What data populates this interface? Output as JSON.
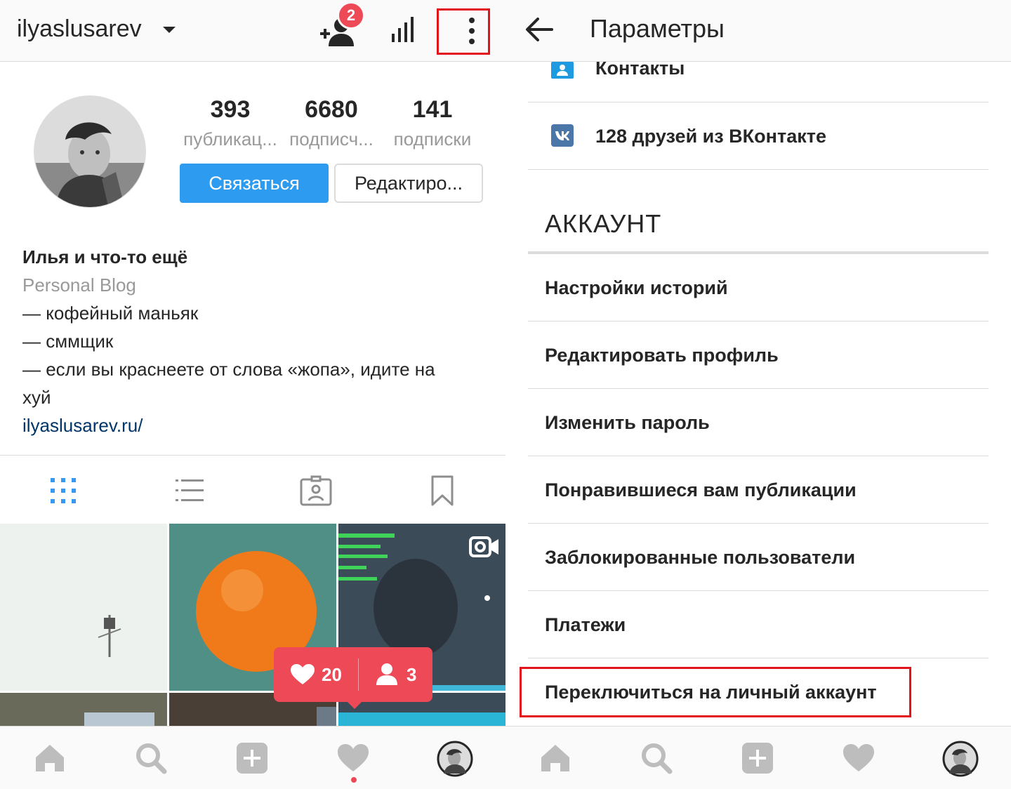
{
  "left": {
    "header": {
      "username": "ilyaslusarev",
      "follow_requests_badge": "2"
    },
    "stats": [
      {
        "value": "393",
        "label": "публикац..."
      },
      {
        "value": "6680",
        "label": "подписч..."
      },
      {
        "value": "141",
        "label": "подписки"
      }
    ],
    "buttons": {
      "contact": "Связаться",
      "edit": "Редактиро..."
    },
    "bio": {
      "name": "Илья и что-то ещё",
      "category": "Personal Blog",
      "lines": [
        "— кофейный маньяк",
        "— сммщик",
        "— если вы краснеете от слова «жопа», идите на",
        "хуй"
      ],
      "link": "ilyaslusarev.ru/"
    },
    "activity_popup": {
      "likes": "20",
      "followers": "3"
    },
    "tabs": [
      "grid-icon",
      "list-icon",
      "tagged-icon",
      "saved-icon"
    ],
    "bottom_nav": [
      "home-icon",
      "search-icon",
      "add-icon",
      "heart-icon",
      "profile-avatar"
    ]
  },
  "right": {
    "header": {
      "title": "Параметры"
    },
    "rows_top": [
      {
        "label": "Контакты",
        "icon": "contacts-icon"
      },
      {
        "label": "128 друзей из ВКонтакте",
        "icon": "vk-icon"
      }
    ],
    "section_title": "АККАУНТ",
    "rows": [
      "Настройки историй",
      "Редактировать профиль",
      "Изменить пароль",
      "Понравившиеся вам публикации",
      "Заблокированные пользователи",
      "Платежи",
      "Переключиться на личный аккаунт"
    ]
  },
  "colors": {
    "accent_blue": "#2d9cf0",
    "notification_red": "#ed4956",
    "highlight_red": "#e3131b",
    "link_blue": "#003569",
    "vk_blue": "#4a76a8",
    "contacts_blue": "#1e9ae0"
  }
}
